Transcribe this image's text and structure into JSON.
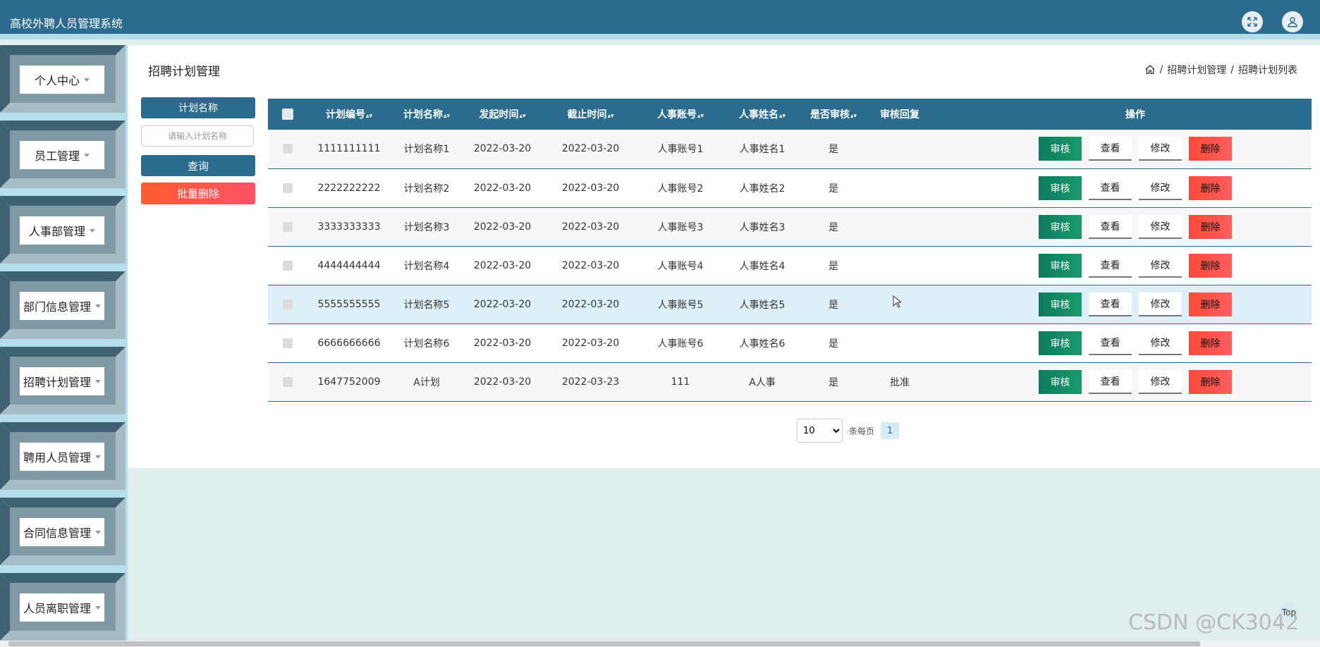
{
  "app": {
    "title": "高校外聘人员管理系统"
  },
  "header_icons": [
    "fullscreen-icon",
    "user-icon"
  ],
  "sidebar": {
    "items": [
      {
        "label": "个人中心"
      },
      {
        "label": "员工管理"
      },
      {
        "label": "人事部管理"
      },
      {
        "label": "部门信息管理"
      },
      {
        "label": "招聘计划管理"
      },
      {
        "label": "聘用人员管理"
      },
      {
        "label": "合同信息管理"
      },
      {
        "label": "人员离职管理"
      }
    ]
  },
  "page": {
    "title": "招聘计划管理",
    "breadcrumb": [
      "招聘计划管理",
      "招聘计划列表"
    ]
  },
  "search": {
    "label": "计划名称",
    "placeholder": "请输入计划名称",
    "query_label": "查询",
    "batch_delete_label": "批量删除"
  },
  "table": {
    "columns": [
      "计划编号",
      "计划名称",
      "发起时间",
      "截止时间",
      "人事账号",
      "人事姓名",
      "是否审核",
      "审核回复",
      "操作"
    ],
    "sortable": [
      true,
      true,
      true,
      true,
      true,
      true,
      true,
      false,
      false
    ],
    "action_labels": {
      "audit": "审核",
      "view": "查看",
      "edit": "修改",
      "delete": "删除"
    },
    "rows": [
      {
        "code": "1111111111",
        "name": "计划名称1",
        "start": "2022-03-20",
        "end": "2022-03-20",
        "account": "人事账号1",
        "person": "人事姓名1",
        "audited": "是",
        "reply": ""
      },
      {
        "code": "2222222222",
        "name": "计划名称2",
        "start": "2022-03-20",
        "end": "2022-03-20",
        "account": "人事账号2",
        "person": "人事姓名2",
        "audited": "是",
        "reply": ""
      },
      {
        "code": "3333333333",
        "name": "计划名称3",
        "start": "2022-03-20",
        "end": "2022-03-20",
        "account": "人事账号3",
        "person": "人事姓名3",
        "audited": "是",
        "reply": ""
      },
      {
        "code": "4444444444",
        "name": "计划名称4",
        "start": "2022-03-20",
        "end": "2022-03-20",
        "account": "人事账号4",
        "person": "人事姓名4",
        "audited": "是",
        "reply": ""
      },
      {
        "code": "5555555555",
        "name": "计划名称5",
        "start": "2022-03-20",
        "end": "2022-03-20",
        "account": "人事账号5",
        "person": "人事姓名5",
        "audited": "是",
        "reply": ""
      },
      {
        "code": "6666666666",
        "name": "计划名称6",
        "start": "2022-03-20",
        "end": "2022-03-20",
        "account": "人事账号6",
        "person": "人事姓名6",
        "audited": "是",
        "reply": ""
      },
      {
        "code": "1647752009",
        "name": "A计划",
        "start": "2022-03-20",
        "end": "2022-03-23",
        "account": "111",
        "person": "A人事",
        "audited": "是",
        "reply": "批准"
      }
    ]
  },
  "pagination": {
    "page_size": "10",
    "page_size_options": [
      "10"
    ],
    "per_page_label": "条每页",
    "current_page": "1"
  },
  "top_button": "Top",
  "watermark": "CSDN @CK3042",
  "colors": {
    "primary": "#2b6c8e",
    "sidebar_bg": "#b6dfee",
    "page_bg": "#e1efec",
    "audit_green": "#138a63",
    "delete_red": "#ff5249"
  }
}
